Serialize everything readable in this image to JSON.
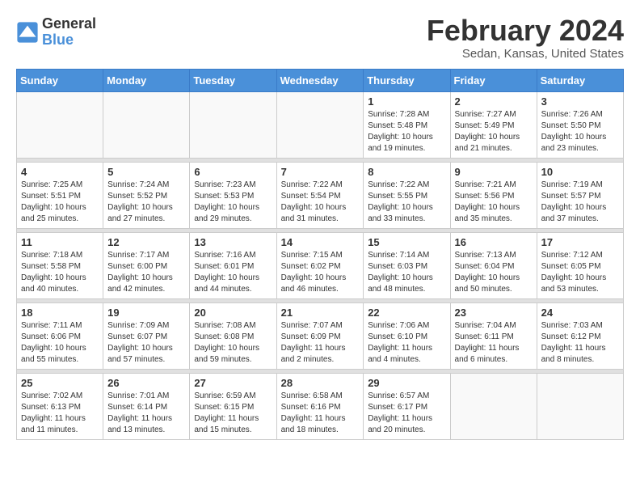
{
  "logo": {
    "text_general": "General",
    "text_blue": "Blue"
  },
  "title": "February 2024",
  "subtitle": "Sedan, Kansas, United States",
  "days_of_week": [
    "Sunday",
    "Monday",
    "Tuesday",
    "Wednesday",
    "Thursday",
    "Friday",
    "Saturday"
  ],
  "weeks": [
    [
      {
        "day": "",
        "info": ""
      },
      {
        "day": "",
        "info": ""
      },
      {
        "day": "",
        "info": ""
      },
      {
        "day": "",
        "info": ""
      },
      {
        "day": "1",
        "info": "Sunrise: 7:28 AM\nSunset: 5:48 PM\nDaylight: 10 hours\nand 19 minutes."
      },
      {
        "day": "2",
        "info": "Sunrise: 7:27 AM\nSunset: 5:49 PM\nDaylight: 10 hours\nand 21 minutes."
      },
      {
        "day": "3",
        "info": "Sunrise: 7:26 AM\nSunset: 5:50 PM\nDaylight: 10 hours\nand 23 minutes."
      }
    ],
    [
      {
        "day": "4",
        "info": "Sunrise: 7:25 AM\nSunset: 5:51 PM\nDaylight: 10 hours\nand 25 minutes."
      },
      {
        "day": "5",
        "info": "Sunrise: 7:24 AM\nSunset: 5:52 PM\nDaylight: 10 hours\nand 27 minutes."
      },
      {
        "day": "6",
        "info": "Sunrise: 7:23 AM\nSunset: 5:53 PM\nDaylight: 10 hours\nand 29 minutes."
      },
      {
        "day": "7",
        "info": "Sunrise: 7:22 AM\nSunset: 5:54 PM\nDaylight: 10 hours\nand 31 minutes."
      },
      {
        "day": "8",
        "info": "Sunrise: 7:22 AM\nSunset: 5:55 PM\nDaylight: 10 hours\nand 33 minutes."
      },
      {
        "day": "9",
        "info": "Sunrise: 7:21 AM\nSunset: 5:56 PM\nDaylight: 10 hours\nand 35 minutes."
      },
      {
        "day": "10",
        "info": "Sunrise: 7:19 AM\nSunset: 5:57 PM\nDaylight: 10 hours\nand 37 minutes."
      }
    ],
    [
      {
        "day": "11",
        "info": "Sunrise: 7:18 AM\nSunset: 5:58 PM\nDaylight: 10 hours\nand 40 minutes."
      },
      {
        "day": "12",
        "info": "Sunrise: 7:17 AM\nSunset: 6:00 PM\nDaylight: 10 hours\nand 42 minutes."
      },
      {
        "day": "13",
        "info": "Sunrise: 7:16 AM\nSunset: 6:01 PM\nDaylight: 10 hours\nand 44 minutes."
      },
      {
        "day": "14",
        "info": "Sunrise: 7:15 AM\nSunset: 6:02 PM\nDaylight: 10 hours\nand 46 minutes."
      },
      {
        "day": "15",
        "info": "Sunrise: 7:14 AM\nSunset: 6:03 PM\nDaylight: 10 hours\nand 48 minutes."
      },
      {
        "day": "16",
        "info": "Sunrise: 7:13 AM\nSunset: 6:04 PM\nDaylight: 10 hours\nand 50 minutes."
      },
      {
        "day": "17",
        "info": "Sunrise: 7:12 AM\nSunset: 6:05 PM\nDaylight: 10 hours\nand 53 minutes."
      }
    ],
    [
      {
        "day": "18",
        "info": "Sunrise: 7:11 AM\nSunset: 6:06 PM\nDaylight: 10 hours\nand 55 minutes."
      },
      {
        "day": "19",
        "info": "Sunrise: 7:09 AM\nSunset: 6:07 PM\nDaylight: 10 hours\nand 57 minutes."
      },
      {
        "day": "20",
        "info": "Sunrise: 7:08 AM\nSunset: 6:08 PM\nDaylight: 10 hours\nand 59 minutes."
      },
      {
        "day": "21",
        "info": "Sunrise: 7:07 AM\nSunset: 6:09 PM\nDaylight: 11 hours\nand 2 minutes."
      },
      {
        "day": "22",
        "info": "Sunrise: 7:06 AM\nSunset: 6:10 PM\nDaylight: 11 hours\nand 4 minutes."
      },
      {
        "day": "23",
        "info": "Sunrise: 7:04 AM\nSunset: 6:11 PM\nDaylight: 11 hours\nand 6 minutes."
      },
      {
        "day": "24",
        "info": "Sunrise: 7:03 AM\nSunset: 6:12 PM\nDaylight: 11 hours\nand 8 minutes."
      }
    ],
    [
      {
        "day": "25",
        "info": "Sunrise: 7:02 AM\nSunset: 6:13 PM\nDaylight: 11 hours\nand 11 minutes."
      },
      {
        "day": "26",
        "info": "Sunrise: 7:01 AM\nSunset: 6:14 PM\nDaylight: 11 hours\nand 13 minutes."
      },
      {
        "day": "27",
        "info": "Sunrise: 6:59 AM\nSunset: 6:15 PM\nDaylight: 11 hours\nand 15 minutes."
      },
      {
        "day": "28",
        "info": "Sunrise: 6:58 AM\nSunset: 6:16 PM\nDaylight: 11 hours\nand 18 minutes."
      },
      {
        "day": "29",
        "info": "Sunrise: 6:57 AM\nSunset: 6:17 PM\nDaylight: 11 hours\nand 20 minutes."
      },
      {
        "day": "",
        "info": ""
      },
      {
        "day": "",
        "info": ""
      }
    ]
  ]
}
